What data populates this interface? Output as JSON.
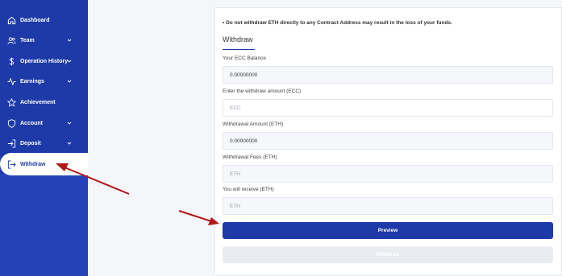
{
  "sidebar": {
    "items": [
      {
        "label": "Dashboard",
        "icon": "home-icon",
        "has_chevron": false
      },
      {
        "label": "Team",
        "icon": "users-icon",
        "has_chevron": true
      },
      {
        "label": "Operation History",
        "icon": "dollar-icon",
        "has_chevron": true
      },
      {
        "label": "Earnings",
        "icon": "activity-icon",
        "has_chevron": true
      },
      {
        "label": "Achievement",
        "icon": "star-icon",
        "has_chevron": false
      },
      {
        "label": "Account",
        "icon": "shield-icon",
        "has_chevron": true
      },
      {
        "label": "Deposit",
        "icon": "login-icon",
        "has_chevron": true
      },
      {
        "label": "Withdraw",
        "icon": "logout-icon",
        "has_chevron": false,
        "active": true
      }
    ],
    "colors": {
      "bg": "#1e3aa8",
      "active_bg": "#ffffff",
      "active_text": "#1e3aa8"
    }
  },
  "withdraw": {
    "warning": "Do not withdraw ETH directly to any Contract Address may result in the loss of your funds.",
    "title": "Withdraw",
    "ecc_balance_label": "Your ECC Balance",
    "ecc_balance_value": "0.00000000",
    "amount_label": "Enter the withdraw amount (ECC)",
    "amount_placeholder": "ECC",
    "eth_amount_label": "Withdrawal Amount (ETH)",
    "eth_amount_value": "0.00000000",
    "fees_label": "Withdrawal Fees (ETH)",
    "fees_placeholder": "ETH",
    "receive_label": "You will receive (ETH)",
    "receive_placeholder": "ETH",
    "preview_button": "Preview",
    "withdraw_button": "Withdraw"
  },
  "colors": {
    "accent": "#1e3aa8",
    "annotation_arrow": "#b01818"
  }
}
